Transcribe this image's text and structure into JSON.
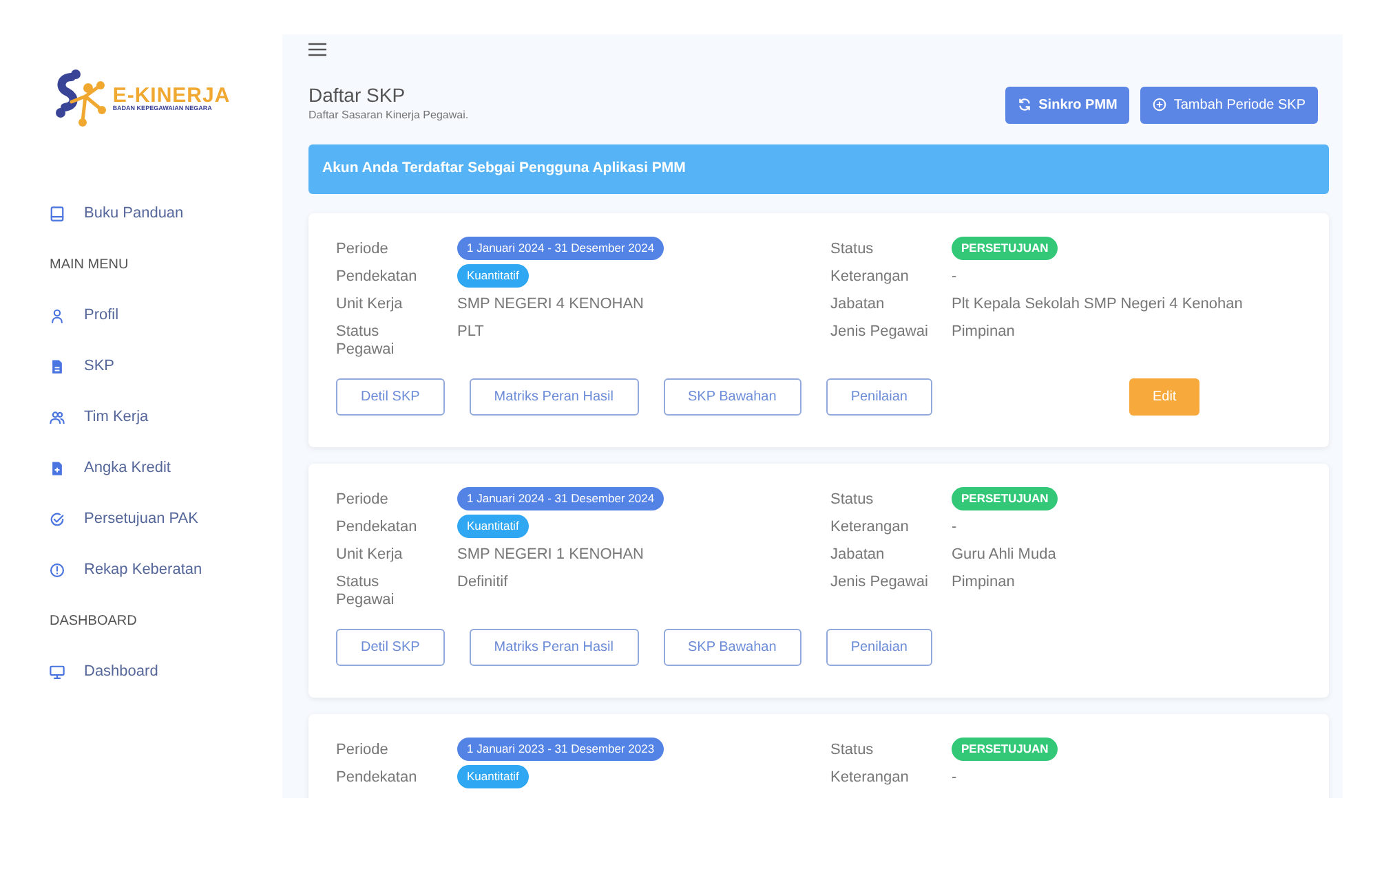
{
  "logo": {
    "title": "E-KINERJA",
    "subtitle": "BADAN KEPEGAWAIAN NEGARA"
  },
  "sidebar": {
    "items": [
      {
        "kind": "item",
        "label": "Buku Panduan"
      },
      {
        "kind": "heading",
        "label": "MAIN MENU"
      },
      {
        "kind": "item",
        "label": "Profil"
      },
      {
        "kind": "item",
        "label": "SKP"
      },
      {
        "kind": "item",
        "label": "Tim Kerja"
      },
      {
        "kind": "item",
        "label": "Angka Kredit"
      },
      {
        "kind": "item",
        "label": "Persetujuan PAK"
      },
      {
        "kind": "item",
        "label": "Rekap Keberatan"
      },
      {
        "kind": "heading",
        "label": "DASHBOARD"
      },
      {
        "kind": "item",
        "label": "Dashboard"
      }
    ]
  },
  "header": {
    "title": "Daftar SKP",
    "subtitle": "Daftar Sasaran Kinerja Pegawai.",
    "buttons": [
      {
        "kind": "sync",
        "label": "Sinkro PMM"
      },
      {
        "kind": "add",
        "label": "Tambah Periode SKP"
      }
    ]
  },
  "alert": "Akun Anda Terdaftar Sebgai Pengguna Aplikasi PMM",
  "cards": [
    {
      "left": [
        {
          "label": "Periode",
          "value": "1 Januari 2024 - 31 Desember 2024",
          "kind": "period"
        },
        {
          "label": "Pendekatan",
          "value": "Kuantitatif",
          "kind": "approach"
        },
        {
          "label": "Unit Kerja",
          "value": "SMP NEGERI 4 KENOHAN",
          "kind": "text"
        },
        {
          "label": "Status Pegawai",
          "value": "PLT",
          "kind": "text"
        }
      ],
      "right": [
        {
          "label": "Status",
          "value": "PERSETUJUAN",
          "kind": "status"
        },
        {
          "label": "Keterangan",
          "value": "-",
          "kind": "text"
        },
        {
          "label": "Jabatan",
          "value": "Plt Kepala Sekolah SMP Negeri 4 Kenohan",
          "kind": "text"
        },
        {
          "label": "Jenis Pegawai",
          "value": "Pimpinan",
          "kind": "text"
        }
      ],
      "buttons": [
        {
          "kind": "outline",
          "label": "Detil SKP"
        },
        {
          "kind": "outline",
          "label": "Matriks Peran Hasil"
        },
        {
          "kind": "outline",
          "label": "SKP Bawahan"
        },
        {
          "kind": "outline",
          "label": "Penilaian"
        },
        {
          "kind": "edit",
          "label": "Edit"
        }
      ]
    },
    {
      "left": [
        {
          "label": "Periode",
          "value": "1 Januari 2024 - 31 Desember 2024",
          "kind": "period"
        },
        {
          "label": "Pendekatan",
          "value": "Kuantitatif",
          "kind": "approach"
        },
        {
          "label": "Unit Kerja",
          "value": "SMP NEGERI 1 KENOHAN",
          "kind": "text"
        },
        {
          "label": "Status Pegawai",
          "value": "Definitif",
          "kind": "text"
        }
      ],
      "right": [
        {
          "label": "Status",
          "value": "PERSETUJUAN",
          "kind": "status"
        },
        {
          "label": "Keterangan",
          "value": "-",
          "kind": "text"
        },
        {
          "label": "Jabatan",
          "value": "Guru Ahli Muda",
          "kind": "text"
        },
        {
          "label": "Jenis Pegawai",
          "value": "Pimpinan",
          "kind": "text"
        }
      ],
      "buttons": [
        {
          "kind": "outline",
          "label": "Detil SKP"
        },
        {
          "kind": "outline",
          "label": "Matriks Peran Hasil"
        },
        {
          "kind": "outline",
          "label": "SKP Bawahan"
        },
        {
          "kind": "outline",
          "label": "Penilaian"
        }
      ]
    },
    {
      "left": [
        {
          "label": "Periode",
          "value": "1 Januari 2023 - 31 Desember 2023",
          "kind": "period"
        },
        {
          "label": "Pendekatan",
          "value": "Kuantitatif",
          "kind": "approach"
        }
      ],
      "right": [
        {
          "label": "Status",
          "value": "PERSETUJUAN",
          "kind": "status"
        },
        {
          "label": "Keterangan",
          "value": "-",
          "kind": "text"
        }
      ]
    }
  ]
}
